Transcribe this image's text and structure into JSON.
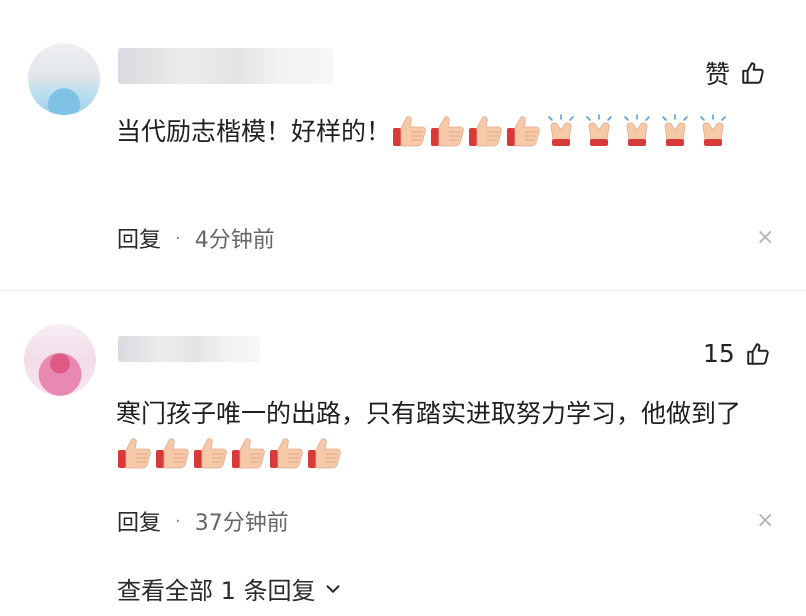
{
  "comments": [
    {
      "like_label": "赞",
      "text": "当代励志楷模！好样的！",
      "emoji_sequence": [
        "thumbs-up",
        "thumbs-up",
        "thumbs-up",
        "thumbs-up",
        "clap",
        "clap",
        "clap",
        "clap",
        "clap"
      ],
      "reply_label": "回复",
      "separator": "·",
      "time": "4分钟前",
      "close_symbol": "×"
    },
    {
      "like_label": "15",
      "text": "寒门孩子唯一的出路，只有踏实进取努力学习，他做到了",
      "emoji_sequence": [
        "thumbs-up",
        "thumbs-up",
        "thumbs-up",
        "thumbs-up",
        "thumbs-up",
        "thumbs-up"
      ],
      "reply_label": "回复",
      "separator": "·",
      "time": "37分钟前",
      "close_symbol": "×"
    }
  ],
  "view_replies_label": "查看全部 1 条回复",
  "icons": {
    "like": "thumbs-up-outline-icon",
    "expand": "chevron-down-icon"
  },
  "colors": {
    "text": "#222222",
    "time": "#666666",
    "close": "#b5b5b5",
    "emoji_skin": "#f6c9a8",
    "emoji_cuff": "#d83a3a"
  }
}
